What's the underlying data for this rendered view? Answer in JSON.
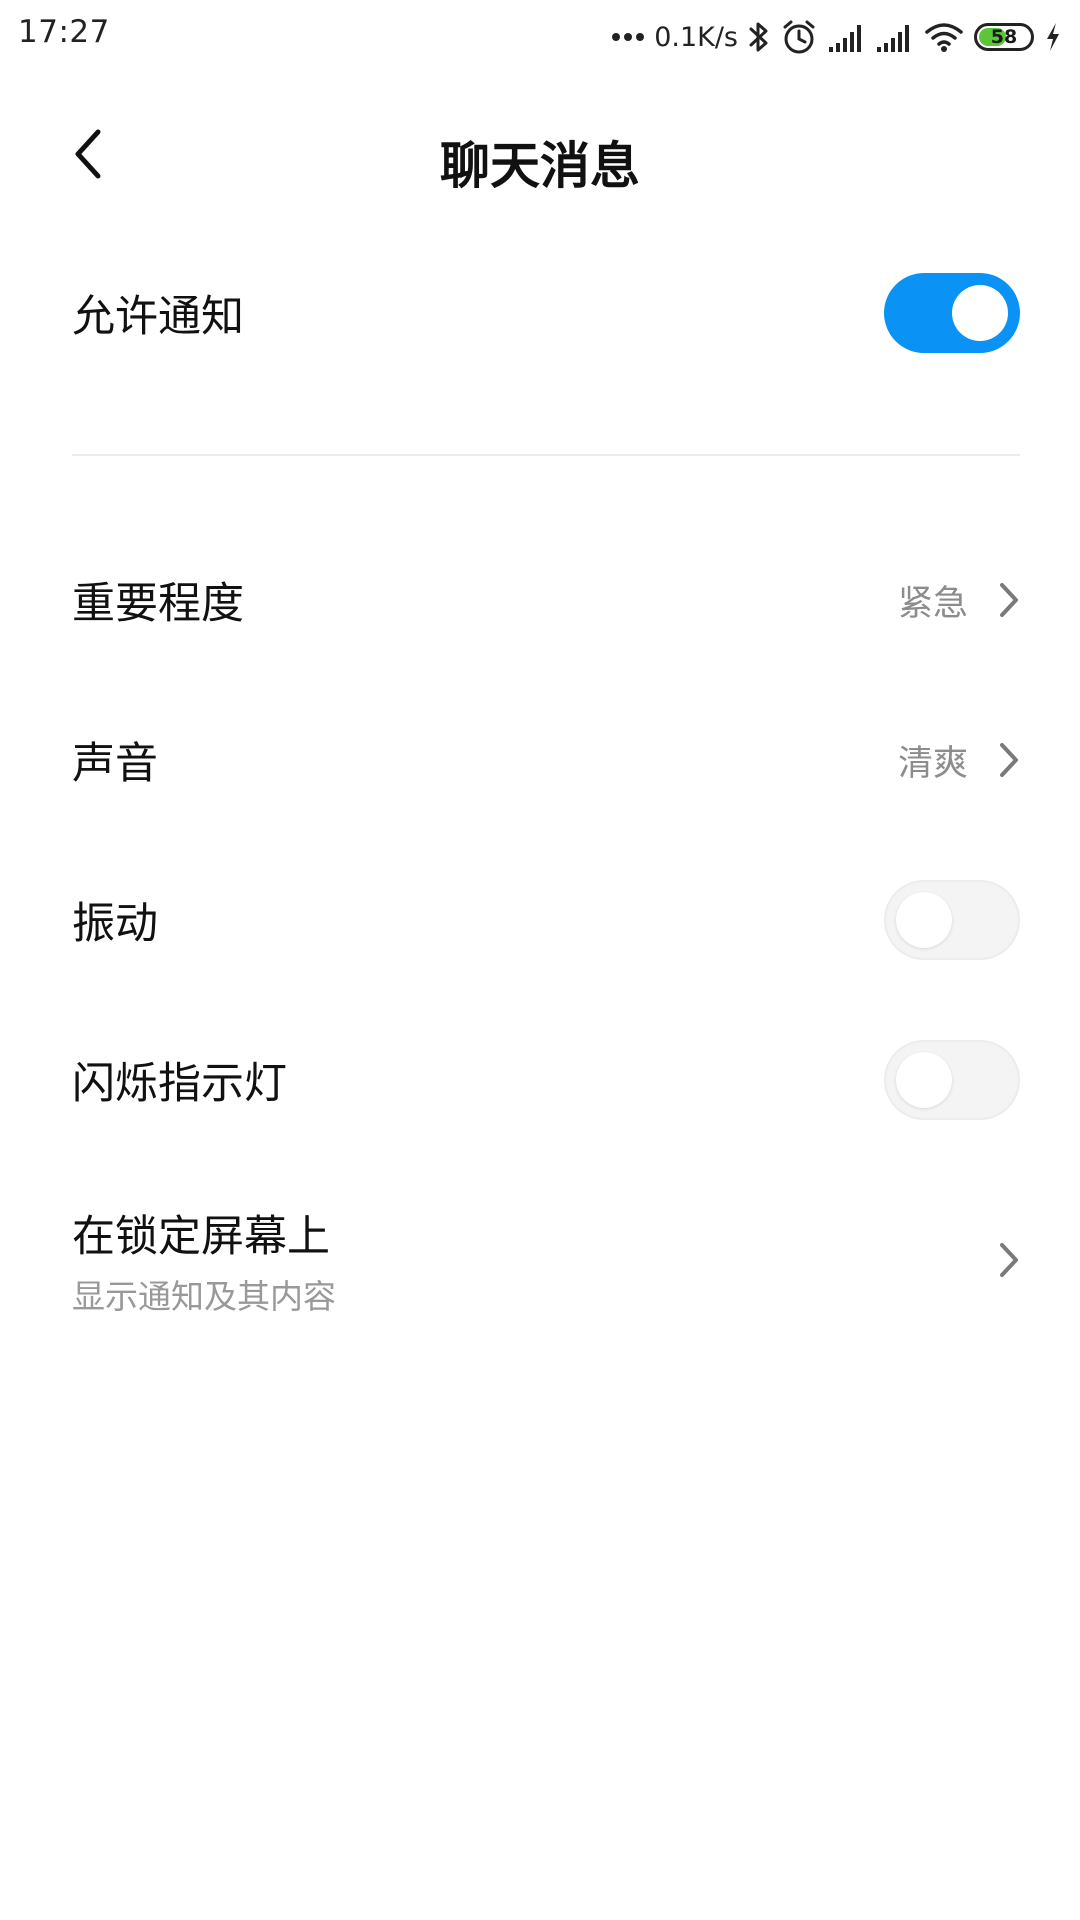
{
  "status_bar": {
    "time": "17:27",
    "network_speed": "0.1K/s",
    "battery_level": "58",
    "battery_percent": 58,
    "battery_color": "#5ac73a",
    "icons": [
      "more-dots-icon",
      "bluetooth-icon",
      "alarm-icon",
      "signal-icon",
      "signal-icon",
      "wifi-icon",
      "battery-icon",
      "charging-icon"
    ]
  },
  "header": {
    "title": "聊天消息",
    "back_icon": "chevron-left-icon"
  },
  "settings": {
    "allow_notifications": {
      "label": "允许通知",
      "enabled": true
    },
    "importance": {
      "label": "重要程度",
      "value": "紧急"
    },
    "sound": {
      "label": "声音",
      "value": "清爽"
    },
    "vibration": {
      "label": "振动",
      "enabled": false
    },
    "blink_light": {
      "label": "闪烁指示灯",
      "enabled": false
    },
    "lock_screen": {
      "label": "在锁定屏幕上",
      "sublabel": "显示通知及其内容"
    }
  },
  "colors": {
    "accent": "#0a93f5",
    "toggle_off": "#f4f4f4",
    "secondary_text": "#8c8c8c"
  }
}
